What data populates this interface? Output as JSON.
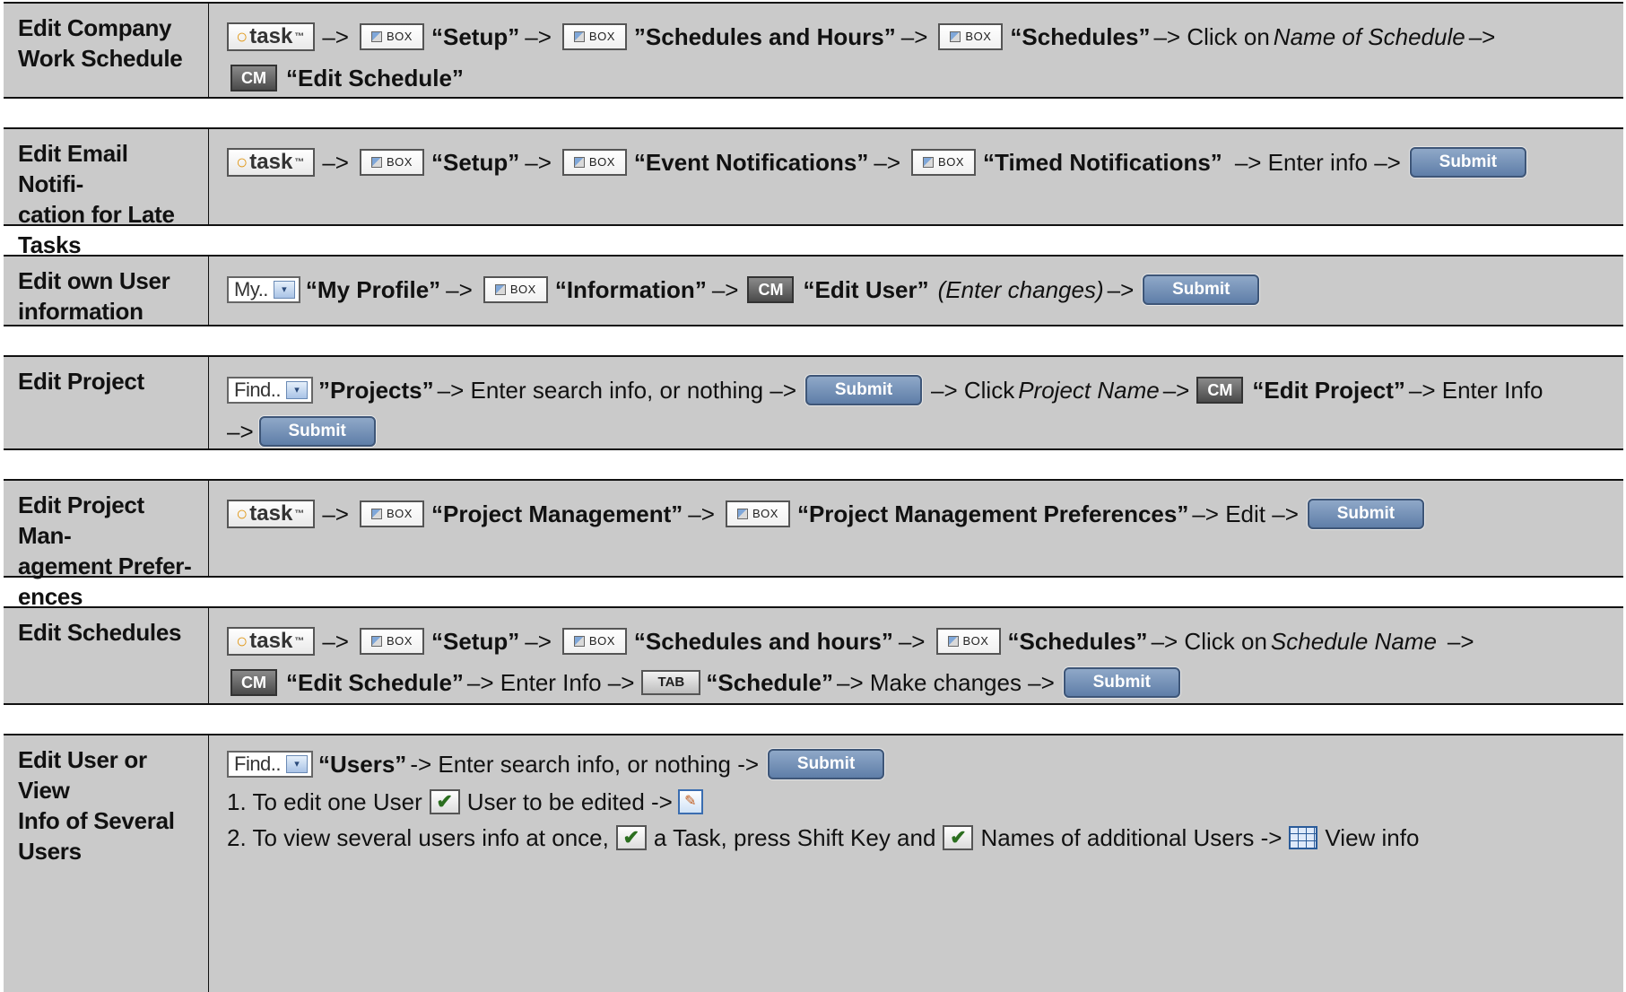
{
  "entries": [
    {
      "label": [
        "Edit Company",
        "Work Schedule"
      ],
      "line1": {
        "p1": "“Setup”",
        "p2": "”Schedules and Hours”",
        "p3": "“Schedules”",
        "t1": "–> Click on",
        "i1": "Name of Schedule",
        "t2": "–>"
      },
      "line2": {
        "p1": "“Edit Schedule”"
      }
    },
    {
      "label": [
        "Edit Email Notifi-",
        "cation for Late",
        "Tasks"
      ],
      "line1": {
        "p1": "“Setup”",
        "p2": "“Event Notifications”",
        "p3": "“Timed Notifications”",
        "t1": "–> Enter info –>"
      }
    },
    {
      "label": [
        "Edit own User",
        "information"
      ],
      "line1": {
        "dd": "My..",
        "p1": "“My Profile”",
        "p2": "“Information”",
        "p3": "“Edit User”",
        "i1": "(Enter changes)",
        "t1": "–>"
      }
    },
    {
      "label": [
        "Edit Project"
      ],
      "line1": {
        "dd": "Find..",
        "p1": "”Projects”",
        "t1": "–> Enter search info, or nothing –>",
        "t2": "–> Click",
        "i1": "Project Name",
        "t3": "–>",
        "p2": "“Edit Project”",
        "t4": "–> Enter Info"
      },
      "line2": {
        "t1": "–>"
      }
    },
    {
      "label": [
        "Edit Project Man-",
        "agement Prefer-",
        "ences"
      ],
      "line1": {
        "p1": "“Project Management”",
        "p2": "“Project Management Preferences”",
        "t1": "–> Edit –>"
      }
    },
    {
      "label": [
        "Edit Schedules"
      ],
      "line1": {
        "p1": "“Setup”",
        "p2": "“Schedules and hours”",
        "p3": "“Schedules”",
        "t1": "–> Click on",
        "i1": "Schedule Name",
        "t2": "–>"
      },
      "line2": {
        "p1": "“Edit Schedule”",
        "t1": "–> Enter Info –>",
        "p2": "“Schedule”",
        "t2": "–> Make changes –>"
      }
    },
    {
      "label": [
        "Edit User or View",
        "Info of Several",
        "Users"
      ],
      "line1": {
        "dd": "Find..",
        "p1": "“Users”",
        "t1": "-> Enter search info, or nothing ->"
      },
      "line2": {
        "t1": "1. To edit one User",
        "t2": "User to be edited ->"
      },
      "line3": {
        "t1": "2. To view several users info at once,",
        "t2": "a Task, press Shift Key and",
        "t3": "Names of additional Users ->",
        "t4": "View info"
      }
    }
  ],
  "common": {
    "arrow": "–>",
    "task_label": "task",
    "task_o": "○",
    "task_tm": "™",
    "box_label": "BOX",
    "cm_label": "CM",
    "tab_label": "TAB",
    "submit_label": "Submit",
    "dd_arrow": "▾",
    "check": "✔",
    "pencil": "✎"
  },
  "colors": {
    "row_bg": "#cacaca",
    "border": "#111111",
    "submit": "#6f8db5",
    "task_accent": "#e19b1f"
  },
  "icons": [
    "task-button-icon",
    "box-icon",
    "cm-icon",
    "tab-icon",
    "submit-button",
    "dropdown-icon",
    "checkbox-icon",
    "edit-icon",
    "view-grid-icon"
  ]
}
